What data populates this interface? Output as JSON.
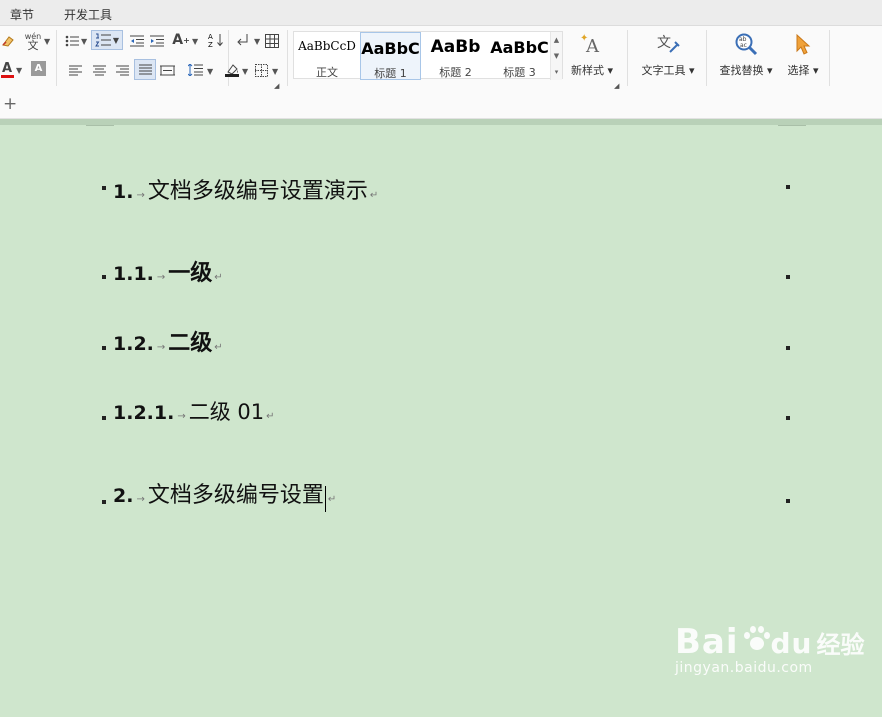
{
  "tabs": [
    "章节",
    "开发工具"
  ],
  "ribbon": {
    "styles": [
      {
        "sample": "AaBbCcD",
        "name": "正文"
      },
      {
        "sample": "AaBbC",
        "name": "标题 1"
      },
      {
        "sample": "AaBb",
        "name": "标题 2"
      },
      {
        "sample": "AaBbC",
        "name": "标题 3"
      }
    ],
    "buttons": {
      "new_style": "新样式",
      "text_tools": "文字工具",
      "find_replace": "查找替换",
      "select": "选择"
    },
    "glyphs": {
      "wen": "wén",
      "wen_char": "文",
      "font_color_letter": "A",
      "shading_letter": "A",
      "font_size_letter": "A",
      "text_tools_char": "文"
    }
  },
  "document": {
    "lines": [
      {
        "num": "1.",
        "text": "文档多级编号设置演示"
      },
      {
        "num": "1.1.",
        "text": "一级"
      },
      {
        "num": "1.2.",
        "text": "二级"
      },
      {
        "num": "1.2.1.",
        "text": "二级 01"
      },
      {
        "num": "2.",
        "text": "文档多级编号设置"
      }
    ],
    "tab_mark": "→",
    "para_mark": "↵"
  },
  "watermark": {
    "logo_left": "Bai",
    "logo_right": "经验",
    "url": "jingyan.baidu.com"
  },
  "colors": {
    "page_background": "#cfe6cd",
    "ribbon": "#fafafa",
    "selected_style": "#eef4fb"
  }
}
